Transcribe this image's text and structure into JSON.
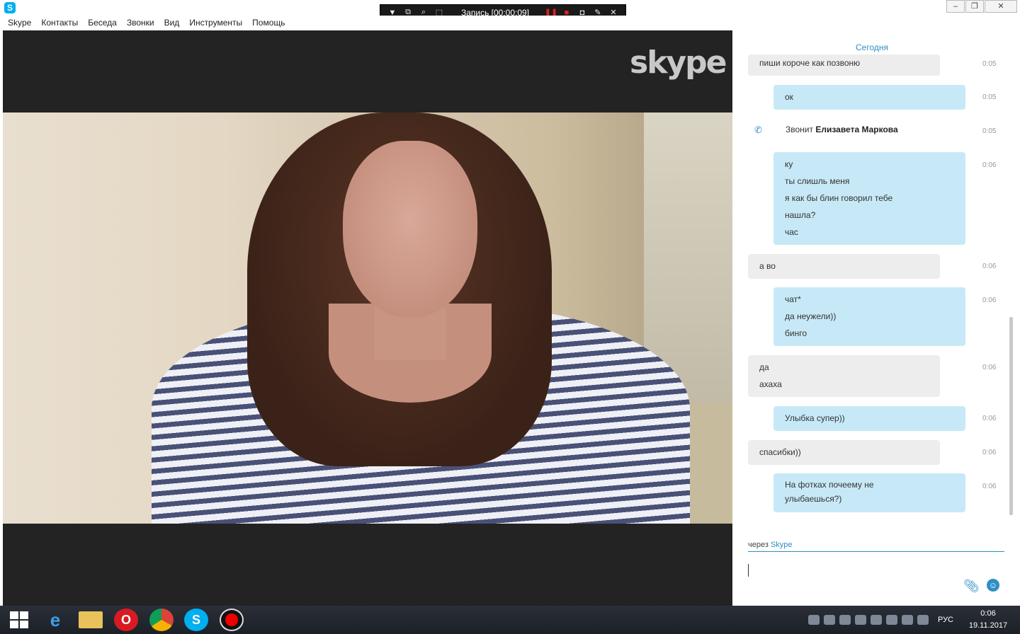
{
  "window": {
    "title": "Skype",
    "controls": [
      "–",
      "❐",
      "✕"
    ]
  },
  "recorder": {
    "label": "Запись [00:00:09]"
  },
  "menu": [
    "Skype",
    "Контакты",
    "Беседа",
    "Звонки",
    "Вид",
    "Инструменты",
    "Помощь"
  ],
  "video": {
    "watermark": "skype"
  },
  "chat": {
    "date_header": "Сегодня",
    "messages": [
      {
        "dir": "in",
        "lines": [
          "пиши короче как позвоню"
        ],
        "time": "0:05"
      },
      {
        "dir": "out",
        "lines": [
          "ок"
        ],
        "time": "0:05"
      },
      {
        "dir": "call",
        "prefix": "Звонит",
        "name": "Елизавета Маркова",
        "time": "0:05"
      },
      {
        "dir": "out",
        "lines": [
          "ку",
          "ты слишль меня",
          "я как бы блин говорил тебе",
          "нашла?",
          "час"
        ],
        "time": "0:06"
      },
      {
        "dir": "in",
        "lines": [
          "а во"
        ],
        "time": "0:06"
      },
      {
        "dir": "out",
        "lines": [
          "чат*",
          "да неужели))",
          "бинго"
        ],
        "time": "0:06"
      },
      {
        "dir": "in",
        "lines": [
          "да",
          "ахаха"
        ],
        "time": "0:06"
      },
      {
        "dir": "out",
        "lines": [
          "Улыбка супер))"
        ],
        "time": "0:06"
      },
      {
        "dir": "in",
        "lines": [
          "спасибки))"
        ],
        "time": "0:06"
      },
      {
        "dir": "out",
        "lines": [
          "На фотках почеему не",
          "улыбаешься?)"
        ],
        "time": "0:06"
      }
    ],
    "via_prefix": "через",
    "via_service": "Skype",
    "input_value": ""
  },
  "taskbar": {
    "apps": [
      "internet-explorer",
      "file-explorer",
      "opera",
      "chrome",
      "skype",
      "recorder"
    ],
    "lang": "РУС",
    "time": "0:06",
    "date": "19.11.2017"
  }
}
